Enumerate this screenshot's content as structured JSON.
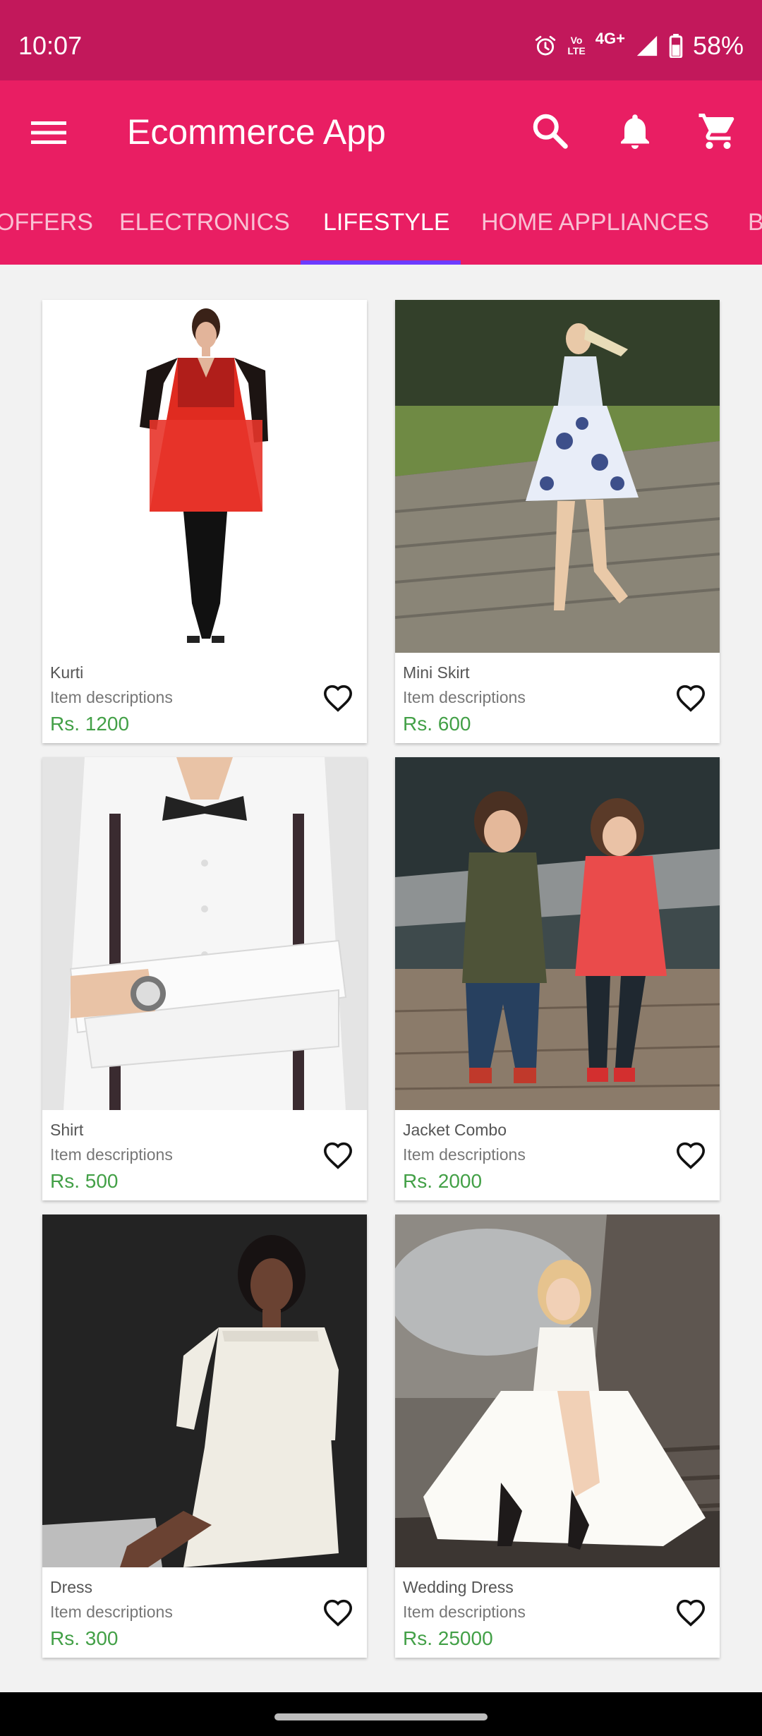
{
  "status_bar": {
    "time": "10:07",
    "volte": "Vo\nLTE",
    "network": "4G+",
    "battery": "58%",
    "icons": [
      "alarm-icon",
      "volte-icon",
      "signal-icon",
      "battery-icon"
    ]
  },
  "app_bar": {
    "title": "Ecommerce App",
    "icons": [
      "menu-icon",
      "search-icon",
      "bell-icon",
      "cart-icon"
    ],
    "color": "#e91e63"
  },
  "tabs": [
    {
      "label": "OFFERS",
      "active": false
    },
    {
      "label": "ELECTRONICS",
      "active": false
    },
    {
      "label": "LIFESTYLE",
      "active": true
    },
    {
      "label": "HOME APPLIANCES",
      "active": false
    },
    {
      "label": "B",
      "active": false
    }
  ],
  "products": [
    {
      "name": "Kurti",
      "description": "Item descriptions",
      "price": "Rs. 1200"
    },
    {
      "name": "Mini Skirt",
      "description": "Item descriptions",
      "price": "Rs. 600"
    },
    {
      "name": "Shirt",
      "description": "Item descriptions",
      "price": "Rs. 500"
    },
    {
      "name": "Jacket Combo",
      "description": "Item descriptions",
      "price": "Rs. 2000"
    },
    {
      "name": "Dress",
      "description": "Item descriptions",
      "price": "Rs. 300"
    },
    {
      "name": "Wedding Dress",
      "description": "Item descriptions",
      "price": "Rs. 25000"
    }
  ],
  "colors": {
    "status_bar": "#c2185b",
    "accent": "#e91e63",
    "tab_indicator": "#6d3cff",
    "price": "#43a047"
  }
}
